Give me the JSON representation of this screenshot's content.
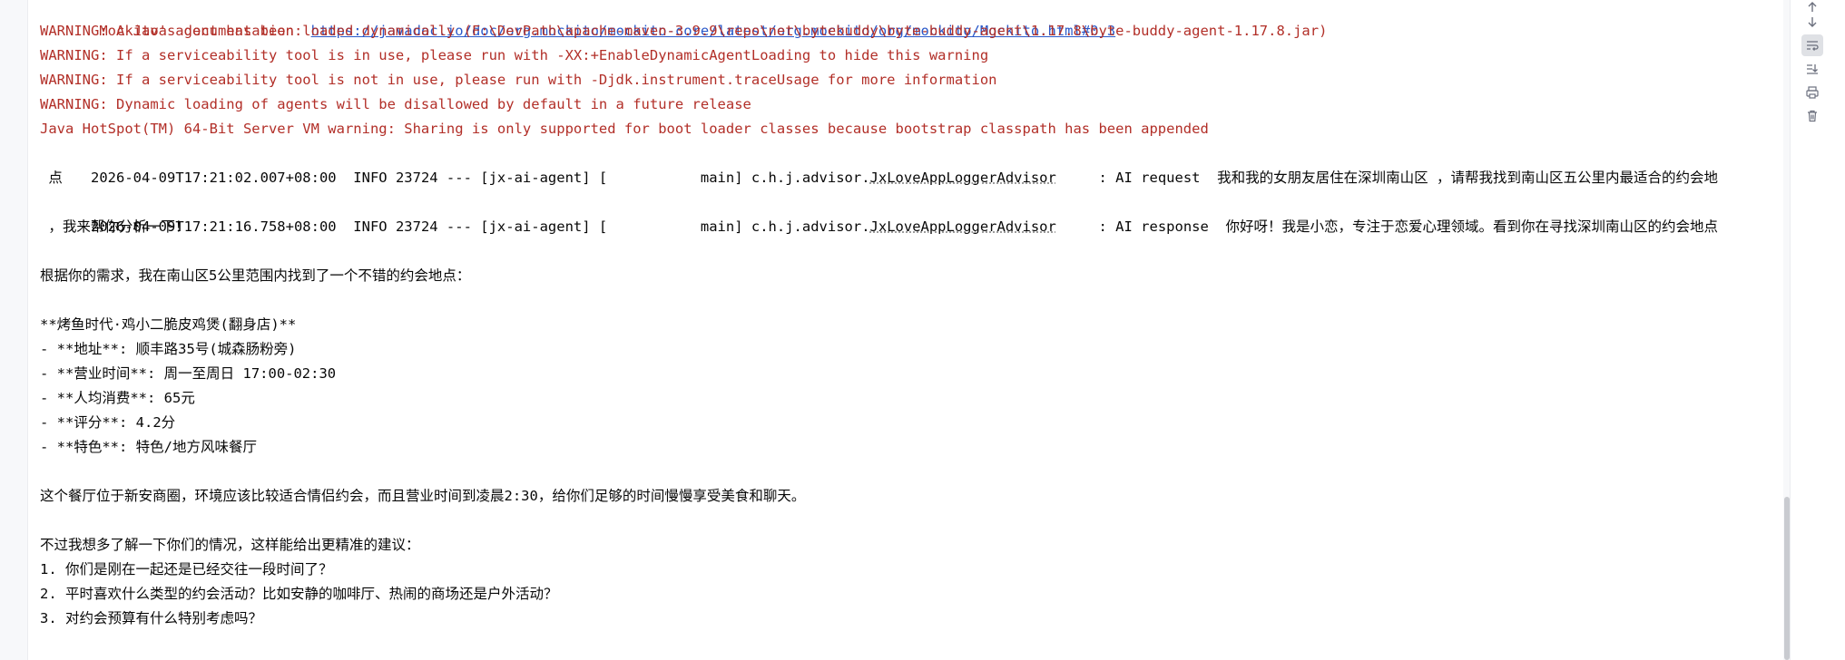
{
  "console": {
    "lines": [
      {
        "prefix": " Mockito's documentation: ",
        "link": "https://javadoc.io/doc/org.mockito/mockito-core/latest/org.mockito/org/mockito/Mockito.html#0.3"
      },
      {
        "text": "WARNING: A Java agent has been loaded dynamically (F:\\DevPath\\apache-maven-3.9.9\\repo\\net\\bytebuddy\\byte-buddy-agent\\1.17.8\\byte-buddy-agent-1.17.8.jar)"
      },
      {
        "text": "WARNING: If a serviceability tool is in use, please run with -XX:+EnableDynamicAgentLoading to hide this warning"
      },
      {
        "text": "WARNING: If a serviceability tool is not in use, please run with -Djdk.instrument.traceUsage for more information"
      },
      {
        "text": "WARNING: Dynamic loading of agents will be disallowed by default in a future release"
      },
      {
        "text": "Java HotSpot(TM) 64-Bit Server VM warning: Sharing is only supported for boot loader classes because bootstrap classpath has been appended"
      },
      {
        "pre": "2026-04-09T17:21:02.007+08:00  INFO 23724 --- [jx-ai-agent] [           main] c.h.j.advisor.",
        "cls": "JxLoveAppLoggerAdvisor",
        "post": "     : AI request  我和我的女朋友居住在深圳南山区 ，请帮我找到南山区五公里内最适合的约会地"
      },
      {
        "text": " 点"
      },
      {
        "pre": "2026-04-09T17:21:16.758+08:00  INFO 23724 --- [jx-ai-agent] [           main] c.h.j.advisor.",
        "cls": "JxLoveAppLoggerAdvisor",
        "post": "     : AI response  你好呀！我是小恋，专注于恋爱心理领域。看到你在寻找深圳南山区的约会地点"
      },
      {
        "text": " ，我来帮你分析一下！"
      },
      {
        "text": ""
      },
      {
        "text": "根据你的需求，我在南山区5公里范围内找到了一个不错的约会地点："
      },
      {
        "text": ""
      },
      {
        "text": "**烤鱼时代·鸡小二脆皮鸡煲(翻身店)**"
      },
      {
        "text": "- **地址**: 顺丰路35号(城森肠粉旁)"
      },
      {
        "text": "- **营业时间**: 周一至周日 17:00-02:30"
      },
      {
        "text": "- **人均消费**: 65元"
      },
      {
        "text": "- **评分**: 4.2分"
      },
      {
        "text": "- **特色**: 特色/地方风味餐厅"
      },
      {
        "text": ""
      },
      {
        "text": "这个餐厅位于新安商圈，环境应该比较适合情侣约会，而且营业时间到凌晨2:30，给你们足够的时间慢慢享受美食和聊天。"
      },
      {
        "text": ""
      },
      {
        "text": "不过我想多了解一下你们的情况，这样能给出更精准的建议："
      },
      {
        "text": "1. 你们是刚在一起还是已经交往一段时间了？"
      },
      {
        "text": "2. 平时喜欢什么类型的约会活动？比如安静的咖啡厅、热闹的商场还是户外活动？"
      },
      {
        "text": "3. 对约会预算有什么特别考虑吗？"
      }
    ]
  },
  "toolbar": {
    "icons": [
      "arrow-up-icon",
      "arrow-down-icon",
      "soft-wrap-icon",
      "scroll-to-end-icon",
      "print-icon",
      "clear-all-icon"
    ]
  },
  "colors": {
    "warning": "#b22f28",
    "link": "#2a59c9",
    "text": "#080808"
  }
}
